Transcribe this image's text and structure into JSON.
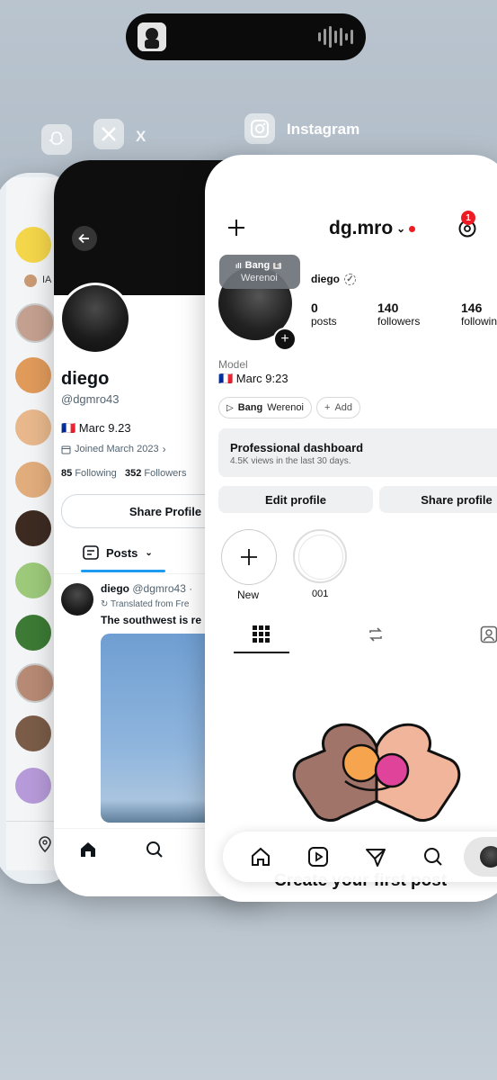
{
  "island": {
    "art_icon": "album-art",
    "wave_icon": "audio-wave-icon"
  },
  "switcher": {
    "x_label": "X",
    "instagram_label": "Instagram"
  },
  "snapchat": {
    "ia_label": "IA"
  },
  "x_profile": {
    "name": "diego",
    "handle": "@dgmro43",
    "bio": "🇫🇷 Marc 9.23",
    "joined": "Joined March 2023",
    "following_count": "85",
    "following_label": "Following",
    "followers_count": "352",
    "followers_label": "Followers",
    "share_button": "Share Profile",
    "posts_tab": "Posts",
    "tweet": {
      "name": "diego",
      "handle": "@dgmro43 ·",
      "translated": "Translated from Fre",
      "text": "The southwest is re"
    }
  },
  "instagram": {
    "username": "dg.mro",
    "threads_badge": "1",
    "music_title": "Bang",
    "music_explicit": "E",
    "music_artist": "Werenoi",
    "display_name": "diego",
    "posts_count": "0",
    "posts_label": "posts",
    "followers_count": "140",
    "followers_label": "followers",
    "following_count": "146",
    "following_label": "followin",
    "category": "Model",
    "bio": "🇫🇷 Marc 9:23",
    "song_chip_title": "Bang",
    "song_chip_artist": "Werenoi",
    "add_chip": "Add",
    "dashboard_title": "Professional dashboard",
    "dashboard_sub": "4.5K views in the last 30 days.",
    "edit_profile": "Edit profile",
    "share_profile": "Share profile",
    "highlight_new": "New",
    "highlight_001": "001",
    "empty_title": "Create your first post"
  },
  "colors": {
    "accent_red": "#ed1c24",
    "x_blue": "#1d9bf0"
  }
}
